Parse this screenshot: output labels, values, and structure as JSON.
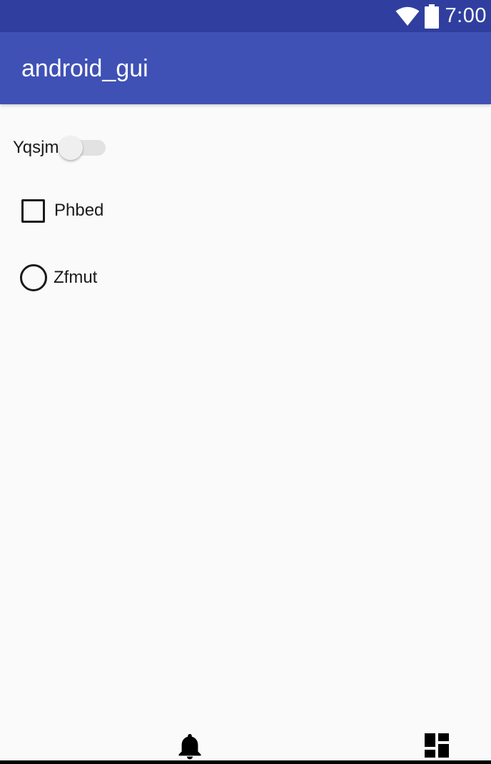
{
  "status_bar": {
    "time": "7:00",
    "icons": [
      "wifi-icon",
      "battery-icon"
    ],
    "background": "#303f9f"
  },
  "app_bar": {
    "title": "android_gui",
    "background": "#3f51b5"
  },
  "content": {
    "switch": {
      "label": "Yqsjm",
      "checked": false
    },
    "checkbox": {
      "label": "Phbed",
      "checked": false
    },
    "radio": {
      "label": "Zfmut",
      "checked": false
    }
  },
  "bottom_icons": [
    "bell-icon",
    "dashboard-icon"
  ]
}
